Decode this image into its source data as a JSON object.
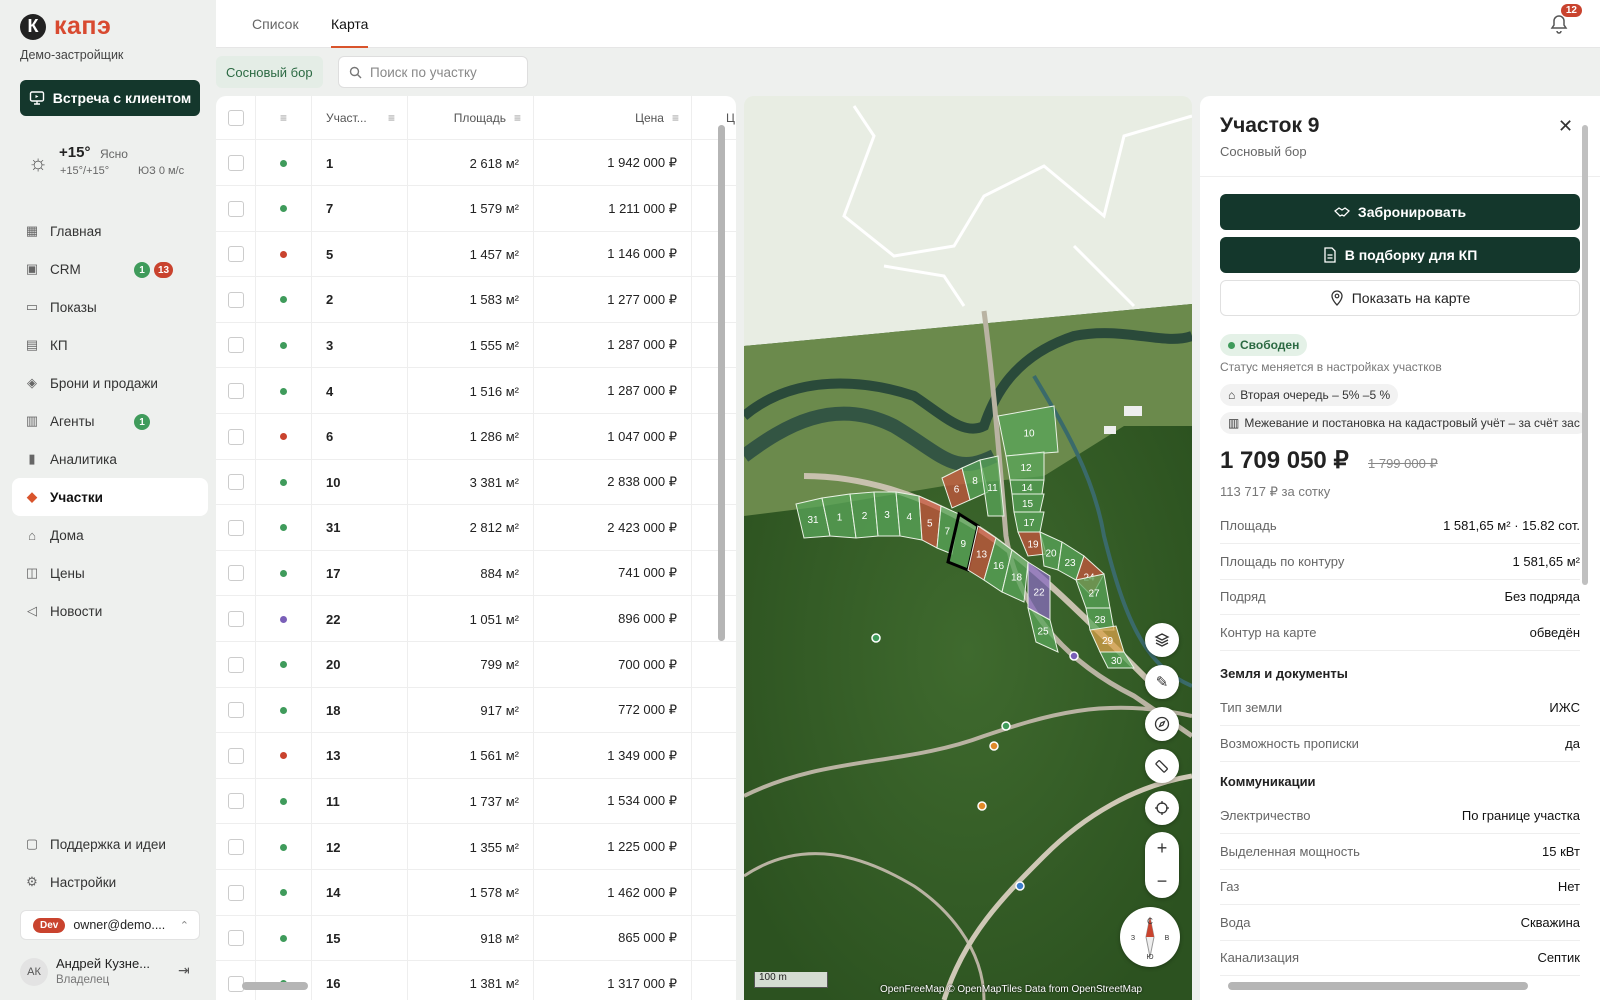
{
  "brand": {
    "logo_letter": "К",
    "name": "капэ",
    "company": "Демо-застройщик"
  },
  "meet_button": "Встреча с клиентом",
  "weather": {
    "temp": "+15°",
    "condition": "Ясно",
    "range": "+15°/+15°",
    "wind": "ЮЗ 0 м/с"
  },
  "nav": [
    {
      "label": "Главная",
      "icon": "grid-icon"
    },
    {
      "label": "CRM",
      "icon": "crm-icon",
      "badge_green": "1",
      "badge_red": "13"
    },
    {
      "label": "Показы",
      "icon": "screen-icon"
    },
    {
      "label": "КП",
      "icon": "document-icon"
    },
    {
      "label": "Брони и продажи",
      "icon": "handshake-icon"
    },
    {
      "label": "Агенты",
      "icon": "briefcase-icon",
      "badge_green": "1"
    },
    {
      "label": "Аналитика",
      "icon": "chart-icon"
    },
    {
      "label": "Участки",
      "icon": "plot-icon",
      "active": true
    },
    {
      "label": "Дома",
      "icon": "home-icon"
    },
    {
      "label": "Цены",
      "icon": "price-icon"
    },
    {
      "label": "Новости",
      "icon": "megaphone-icon"
    }
  ],
  "support": [
    {
      "label": "Поддержка и идеи",
      "icon": "chat-icon"
    },
    {
      "label": "Настройки",
      "icon": "gear-icon"
    }
  ],
  "env": {
    "tag": "Dev",
    "email": "owner@demo...."
  },
  "user": {
    "initials": "АК",
    "name": "Андрей Кузне...",
    "role": "Владелец"
  },
  "tabs": [
    "Список",
    "Карта"
  ],
  "active_tab": "Карта",
  "notifications": "12",
  "filter_chip": "Сосновый бор",
  "search": {
    "placeholder": "Поиск по участку"
  },
  "table": {
    "headers": {
      "plot": "Участ...",
      "area": "Площадь",
      "price": "Цена",
      "extra": "Ц"
    },
    "rows": [
      {
        "num": "1",
        "area": "2 618 м²",
        "price": "1 942 000 ₽",
        "status": "green"
      },
      {
        "num": "7",
        "area": "1 579 м²",
        "price": "1 211 000 ₽",
        "status": "green"
      },
      {
        "num": "5",
        "area": "1 457 м²",
        "price": "1 146 000 ₽",
        "status": "red"
      },
      {
        "num": "2",
        "area": "1 583 м²",
        "price": "1 277 000 ₽",
        "status": "green"
      },
      {
        "num": "3",
        "area": "1 555 м²",
        "price": "1 287 000 ₽",
        "status": "green"
      },
      {
        "num": "4",
        "area": "1 516 м²",
        "price": "1 287 000 ₽",
        "status": "green"
      },
      {
        "num": "6",
        "area": "1 286 м²",
        "price": "1 047 000 ₽",
        "status": "red"
      },
      {
        "num": "10",
        "area": "3 381 м²",
        "price": "2 838 000 ₽",
        "status": "green"
      },
      {
        "num": "31",
        "area": "2 812 м²",
        "price": "2 423 000 ₽",
        "status": "green"
      },
      {
        "num": "17",
        "area": "884 м²",
        "price": "741 000 ₽",
        "status": "green"
      },
      {
        "num": "22",
        "area": "1 051 м²",
        "price": "896 000 ₽",
        "status": "purple"
      },
      {
        "num": "20",
        "area": "799 м²",
        "price": "700 000 ₽",
        "status": "green"
      },
      {
        "num": "18",
        "area": "917 м²",
        "price": "772 000 ₽",
        "status": "green"
      },
      {
        "num": "13",
        "area": "1 561 м²",
        "price": "1 349 000 ₽",
        "status": "red"
      },
      {
        "num": "11",
        "area": "1 737 м²",
        "price": "1 534 000 ₽",
        "status": "green"
      },
      {
        "num": "12",
        "area": "1 355 м²",
        "price": "1 225 000 ₽",
        "status": "green"
      },
      {
        "num": "14",
        "area": "1 578 м²",
        "price": "1 462 000 ₽",
        "status": "green"
      },
      {
        "num": "15",
        "area": "918 м²",
        "price": "865 000 ₽",
        "status": "green"
      },
      {
        "num": "16",
        "area": "1 381 м²",
        "price": "1 317 000 ₽",
        "status": "green"
      }
    ]
  },
  "status_colors": {
    "green": "#3f9b5b",
    "red": "#c9432e",
    "purple": "#7a5fb8"
  },
  "map": {
    "scale": "100 m",
    "attribution": "OpenFreeMap © OpenMapTiles Data from OpenStreetMap",
    "compass": {
      "n": "С",
      "s": "Ю",
      "e": "В",
      "w": "З"
    },
    "plots": [
      {
        "label": "31",
        "status": "green"
      },
      {
        "label": "1",
        "status": "green"
      },
      {
        "label": "2",
        "status": "green"
      },
      {
        "label": "3",
        "status": "green"
      },
      {
        "label": "4",
        "status": "green"
      },
      {
        "label": "5",
        "status": "red"
      },
      {
        "label": "7",
        "status": "green"
      },
      {
        "label": "9",
        "status": "green",
        "selected": true
      },
      {
        "label": "13",
        "status": "red"
      },
      {
        "label": "16",
        "status": "green"
      },
      {
        "label": "18",
        "status": "green"
      },
      {
        "label": "22",
        "status": "purple"
      },
      {
        "label": "25",
        "status": "green"
      },
      {
        "label": "6",
        "status": "red"
      },
      {
        "label": "8",
        "status": "green"
      },
      {
        "label": "11",
        "status": "green"
      },
      {
        "label": "10",
        "status": "green"
      },
      {
        "label": "12",
        "status": "green"
      },
      {
        "label": "14",
        "status": "green"
      },
      {
        "label": "15",
        "status": "green"
      },
      {
        "label": "17",
        "status": "green"
      },
      {
        "label": "19",
        "status": "red"
      },
      {
        "label": "20",
        "status": "green"
      },
      {
        "label": "23",
        "status": "green"
      },
      {
        "label": "24",
        "status": "red"
      },
      {
        "label": "27",
        "status": "green"
      },
      {
        "label": "28",
        "status": "green"
      },
      {
        "label": "29",
        "status": "orange"
      },
      {
        "label": "30",
        "status": "green"
      }
    ]
  },
  "detail": {
    "title": "Участок 9",
    "subtitle": "Сосновый бор",
    "reserve_button": "Забронировать",
    "kp_button": "В подборку для КП",
    "show_on_map": "Показать на карте",
    "status": "Свободен",
    "status_note": "Статус меняется в настройках участков",
    "discount_tag": "Вторая очередь – 5% –5 %",
    "survey_tag": "Межевание и постановка на кадастровый учёт – за счёт зас",
    "price": "1 709 050 ₽",
    "old_price": "1 799 000 ₽",
    "price_per": "113 717 ₽ за сотку",
    "props": [
      {
        "k": "Площадь",
        "v": "1 581,65 м² · 15.82 сот."
      },
      {
        "k": "Площадь по контуру",
        "v": "1 581,65 м²"
      },
      {
        "k": "Подряд",
        "v": "Без подряда"
      },
      {
        "k": "Контур на карте",
        "v": "обведён"
      }
    ],
    "land_section": "Земля и документы",
    "land": [
      {
        "k": "Тип земли",
        "v": "ИЖС"
      },
      {
        "k": "Возможность прописки",
        "v": "да"
      }
    ],
    "comm_section": "Коммуникации",
    "comm": [
      {
        "k": "Электричество",
        "v": "По границе участка"
      },
      {
        "k": "Выделенная мощность",
        "v": "15 кВт"
      },
      {
        "k": "Газ",
        "v": "Нет"
      },
      {
        "k": "Вода",
        "v": "Скважина"
      },
      {
        "k": "Канализация",
        "v": "Септик"
      }
    ]
  }
}
